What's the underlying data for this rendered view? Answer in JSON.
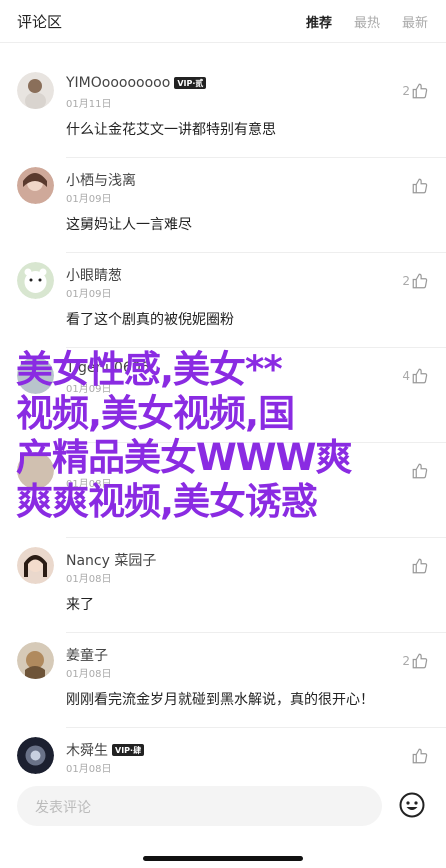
{
  "header": {
    "title": "评论区",
    "tabs": [
      {
        "label": "推荐",
        "active": true
      },
      {
        "label": "最热",
        "active": false
      },
      {
        "label": "最新",
        "active": false
      }
    ]
  },
  "comments": [
    {
      "name": "YIMOoooooooo",
      "badge": "VIP·贰",
      "date": "01月11日",
      "text": "什么让金花艾文一讲都特别有意思",
      "likes": "2"
    },
    {
      "name": "小栖与浅离",
      "badge": "",
      "date": "01月09日",
      "text": "这舅妈让人一言难尽",
      "likes": ""
    },
    {
      "name": "小眼睛葱",
      "badge": "",
      "date": "01月09日",
      "text": "看了这个剧真的被倪妮圈粉",
      "likes": "2"
    },
    {
      "name": "Tigerlu0606",
      "badge": "",
      "date": "01月09日",
      "text": "",
      "likes": "4"
    },
    {
      "name": "",
      "badge": "",
      "date": "01月08日",
      "text": "",
      "likes": ""
    },
    {
      "name": "Nancy 菜园子",
      "badge": "",
      "date": "01月08日",
      "text": "来了",
      "likes": ""
    },
    {
      "name": "姜童子",
      "badge": "",
      "date": "01月08日",
      "text": "刚刚看完流金岁月就碰到黑水解说，真的很开心！",
      "likes": "2"
    },
    {
      "name": "木舜生",
      "badge": "VIP·肆",
      "date": "01月08日",
      "text": "",
      "likes": ""
    }
  ],
  "overlay": {
    "lines": [
      "美女性感,美女**",
      "视频,美女视频,国",
      "产精品美女WWW爽",
      "爽爽视频,美女诱惑"
    ]
  },
  "bottom": {
    "placeholder": "发表评论"
  },
  "colors": {
    "overlay": "#8a2be2",
    "badge": "#222222"
  },
  "icons": [
    "thumbs-up-icon",
    "emoji-icon"
  ]
}
